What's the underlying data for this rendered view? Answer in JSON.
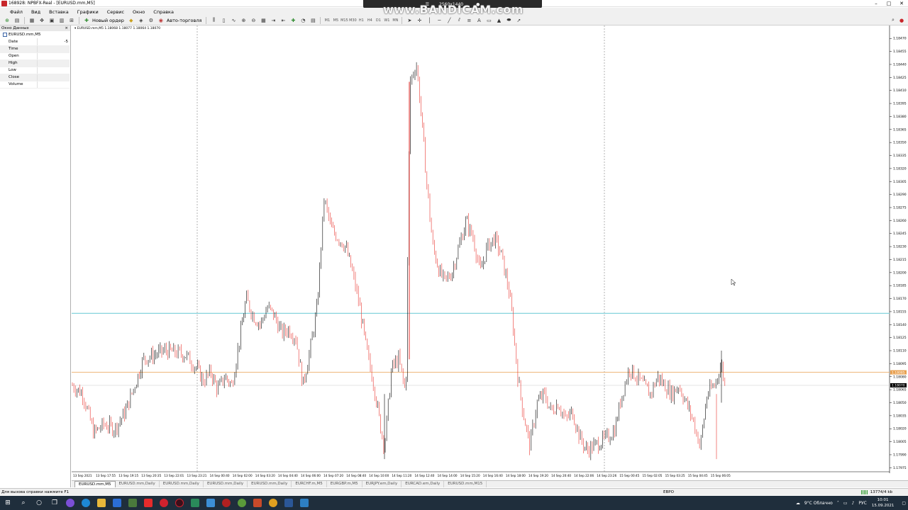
{
  "window": {
    "title": "168928: NPBFX-Real - [EURUSD.mm,M5]",
    "controls": [
      "–",
      "□",
      "✕"
    ]
  },
  "recorder": {
    "resolution": "2560x1440",
    "watermark": "www.BANDICAM.com"
  },
  "menu": {
    "items": [
      "Файл",
      "Вид",
      "Вставка",
      "Графики",
      "Сервис",
      "Окно",
      "Справка"
    ]
  },
  "toolbar": {
    "new_order_label": "Новый ордер",
    "autotrading_label": "Авто-торговля",
    "timeframes": [
      "M1",
      "M5",
      "M15",
      "M30",
      "H1",
      "H4",
      "D1",
      "W1",
      "MN"
    ]
  },
  "data_window": {
    "title": "Окно Данных",
    "symbol": "EURUSD.mm,M5",
    "rows": [
      {
        "label": "Date",
        "value": "-5"
      },
      {
        "label": "Time",
        "value": ""
      },
      {
        "label": "Open",
        "value": ""
      },
      {
        "label": "High",
        "value": ""
      },
      {
        "label": "Low",
        "value": ""
      },
      {
        "label": "Close",
        "value": ""
      },
      {
        "label": "Volume",
        "value": ""
      }
    ]
  },
  "chart": {
    "info": "▾ EURUSD.mm,M5  1.18068 1.18077 1.18064 1.18070",
    "colors": {
      "bull": "#000000",
      "bear": "#e8322c",
      "hline_cyan": "#86d4dd",
      "hline_orange": "#e8a050",
      "hline_gray": "#c8c8c8",
      "vline": "#808080"
    },
    "current_price_label": "1.18070",
    "orange_line_label": "1.18085",
    "cyan_line_label": "1.18153"
  },
  "chart_data": {
    "type": "candlestick",
    "symbol": "EURUSD.mm",
    "timeframe": "M5",
    "y_ticks": [
      "1.18470",
      "1.18455",
      "1.18440",
      "1.18425",
      "1.18410",
      "1.18395",
      "1.18380",
      "1.18365",
      "1.18350",
      "1.18335",
      "1.18320",
      "1.18305",
      "1.18290",
      "1.18275",
      "1.18260",
      "1.18245",
      "1.18230",
      "1.18215",
      "1.18200",
      "1.18185",
      "1.18170",
      "1.18155",
      "1.18140",
      "1.18125",
      "1.18110",
      "1.18095",
      "1.18080",
      "1.18065",
      "1.18050",
      "1.18035",
      "1.18020",
      "1.18005",
      "1.17990",
      "1.17975"
    ],
    "ylim": [
      1.17972,
      1.1848
    ],
    "x_ticks": [
      "13 Sep 2021",
      "13 Sep 17:55",
      "13 Sep 19:15",
      "13 Sep 20:35",
      "13 Sep 22:01",
      "13 Sep 23:21",
      "14 Sep 00:40",
      "14 Sep 02:00",
      "14 Sep 03:20",
      "14 Sep 04:40",
      "14 Sep 06:00",
      "14 Sep 07:20",
      "14 Sep 08:40",
      "14 Sep 10:00",
      "14 Sep 11:20",
      "14 Sep 12:40",
      "14 Sep 14:00",
      "14 Sep 15:20",
      "14 Sep 16:40",
      "14 Sep 18:00",
      "14 Sep 19:20",
      "14 Sep 20:40",
      "14 Sep 22:06",
      "14 Sep 23:26",
      "15 Sep 00:45",
      "15 Sep 02:05",
      "15 Sep 03:25",
      "15 Sep 04:45",
      "15 Sep 06:05"
    ],
    "path_points": [
      [
        0,
        1.1807
      ],
      [
        15,
        1.1806
      ],
      [
        30,
        1.18015
      ],
      [
        45,
        1.18025
      ],
      [
        60,
        1.1802
      ],
      [
        75,
        1.1804
      ],
      [
        90,
        1.18075
      ],
      [
        100,
        1.181
      ],
      [
        115,
        1.18105
      ],
      [
        130,
        1.1811
      ],
      [
        145,
        1.18108
      ],
      [
        160,
        1.18105
      ],
      [
        175,
        1.1809
      ],
      [
        185,
        1.18075
      ],
      [
        195,
        1.18085
      ],
      [
        205,
        1.18065
      ],
      [
        215,
        1.1808
      ],
      [
        225,
        1.1807
      ],
      [
        235,
        1.1812
      ],
      [
        245,
        1.1817
      ],
      [
        255,
        1.1815
      ],
      [
        265,
        1.1814
      ],
      [
        275,
        1.1816
      ],
      [
        285,
        1.1815
      ],
      [
        295,
        1.1813
      ],
      [
        305,
        1.18135
      ],
      [
        315,
        1.18125
      ],
      [
        325,
        1.1807
      ],
      [
        335,
        1.1811
      ],
      [
        345,
        1.1816
      ],
      [
        355,
        1.18285
      ],
      [
        365,
        1.1825
      ],
      [
        375,
        1.1824
      ],
      [
        385,
        1.1823
      ],
      [
        395,
        1.182
      ],
      [
        405,
        1.1816
      ],
      [
        415,
        1.1811
      ],
      [
        425,
        1.1807
      ],
      [
        435,
        1.1802
      ],
      [
        440,
        1.18
      ],
      [
        450,
        1.1809
      ],
      [
        460,
        1.181
      ],
      [
        470,
        1.1806
      ],
      [
        476,
        1.1842
      ],
      [
        485,
        1.1844
      ],
      [
        492,
        1.1838
      ],
      [
        500,
        1.183
      ],
      [
        508,
        1.1823
      ],
      [
        518,
        1.182
      ],
      [
        525,
        1.1819
      ],
      [
        535,
        1.182
      ],
      [
        545,
        1.1823
      ],
      [
        555,
        1.1826
      ],
      [
        565,
        1.1824
      ],
      [
        575,
        1.182
      ],
      [
        585,
        1.1823
      ],
      [
        595,
        1.1824
      ],
      [
        605,
        1.1822
      ],
      [
        615,
        1.1818
      ],
      [
        620,
        1.1815
      ],
      [
        628,
        1.1808
      ],
      [
        635,
        1.1804
      ],
      [
        645,
        1.18
      ],
      [
        655,
        1.1805
      ],
      [
        665,
        1.1806
      ],
      [
        675,
        1.1804
      ],
      [
        685,
        1.1805
      ],
      [
        695,
        1.1803
      ],
      [
        705,
        1.1804
      ],
      [
        715,
        1.1801
      ],
      [
        725,
        1.17995
      ],
      [
        735,
        1.18
      ],
      [
        745,
        1.18005
      ],
      [
        755,
        1.1801
      ],
      [
        765,
        1.1802
      ],
      [
        775,
        1.1806
      ],
      [
        785,
        1.1809
      ],
      [
        795,
        1.1808
      ],
      [
        805,
        1.1807
      ],
      [
        815,
        1.1806
      ],
      [
        825,
        1.1808
      ],
      [
        835,
        1.1807
      ],
      [
        845,
        1.1806
      ],
      [
        855,
        1.1807
      ],
      [
        865,
        1.1805
      ],
      [
        875,
        1.1803
      ],
      [
        885,
        1.18
      ],
      [
        895,
        1.1806
      ],
      [
        905,
        1.1807
      ],
      [
        915,
        1.18095
      ],
      [
        920,
        1.1807
      ]
    ],
    "note_lines": {
      "cyan": 1.18153,
      "orange": 1.18085,
      "current": 1.1807
    }
  },
  "tabs": {
    "items": [
      "EURUSD.mm,M5",
      "EURUSD.mm,Daily",
      "EURUSD.mm,Daily",
      "EURUSD.mm,Daily",
      "EURUSD.mm,Daily",
      "EURCHF.m,M5",
      "EURGBP.m,M5",
      "EURJPY.em,Daily",
      "EURCAD.em,Daily",
      "EURUSD.mm,M15"
    ]
  },
  "status": {
    "help": "Для вызова справки нажмите F1",
    "profile": "ЕВРО",
    "traffic": "13774/4 kb"
  },
  "taskbar": {
    "weather": "9°C  Облачно",
    "lang": "РУС",
    "time": "10:01",
    "date": "15.09.2021"
  }
}
